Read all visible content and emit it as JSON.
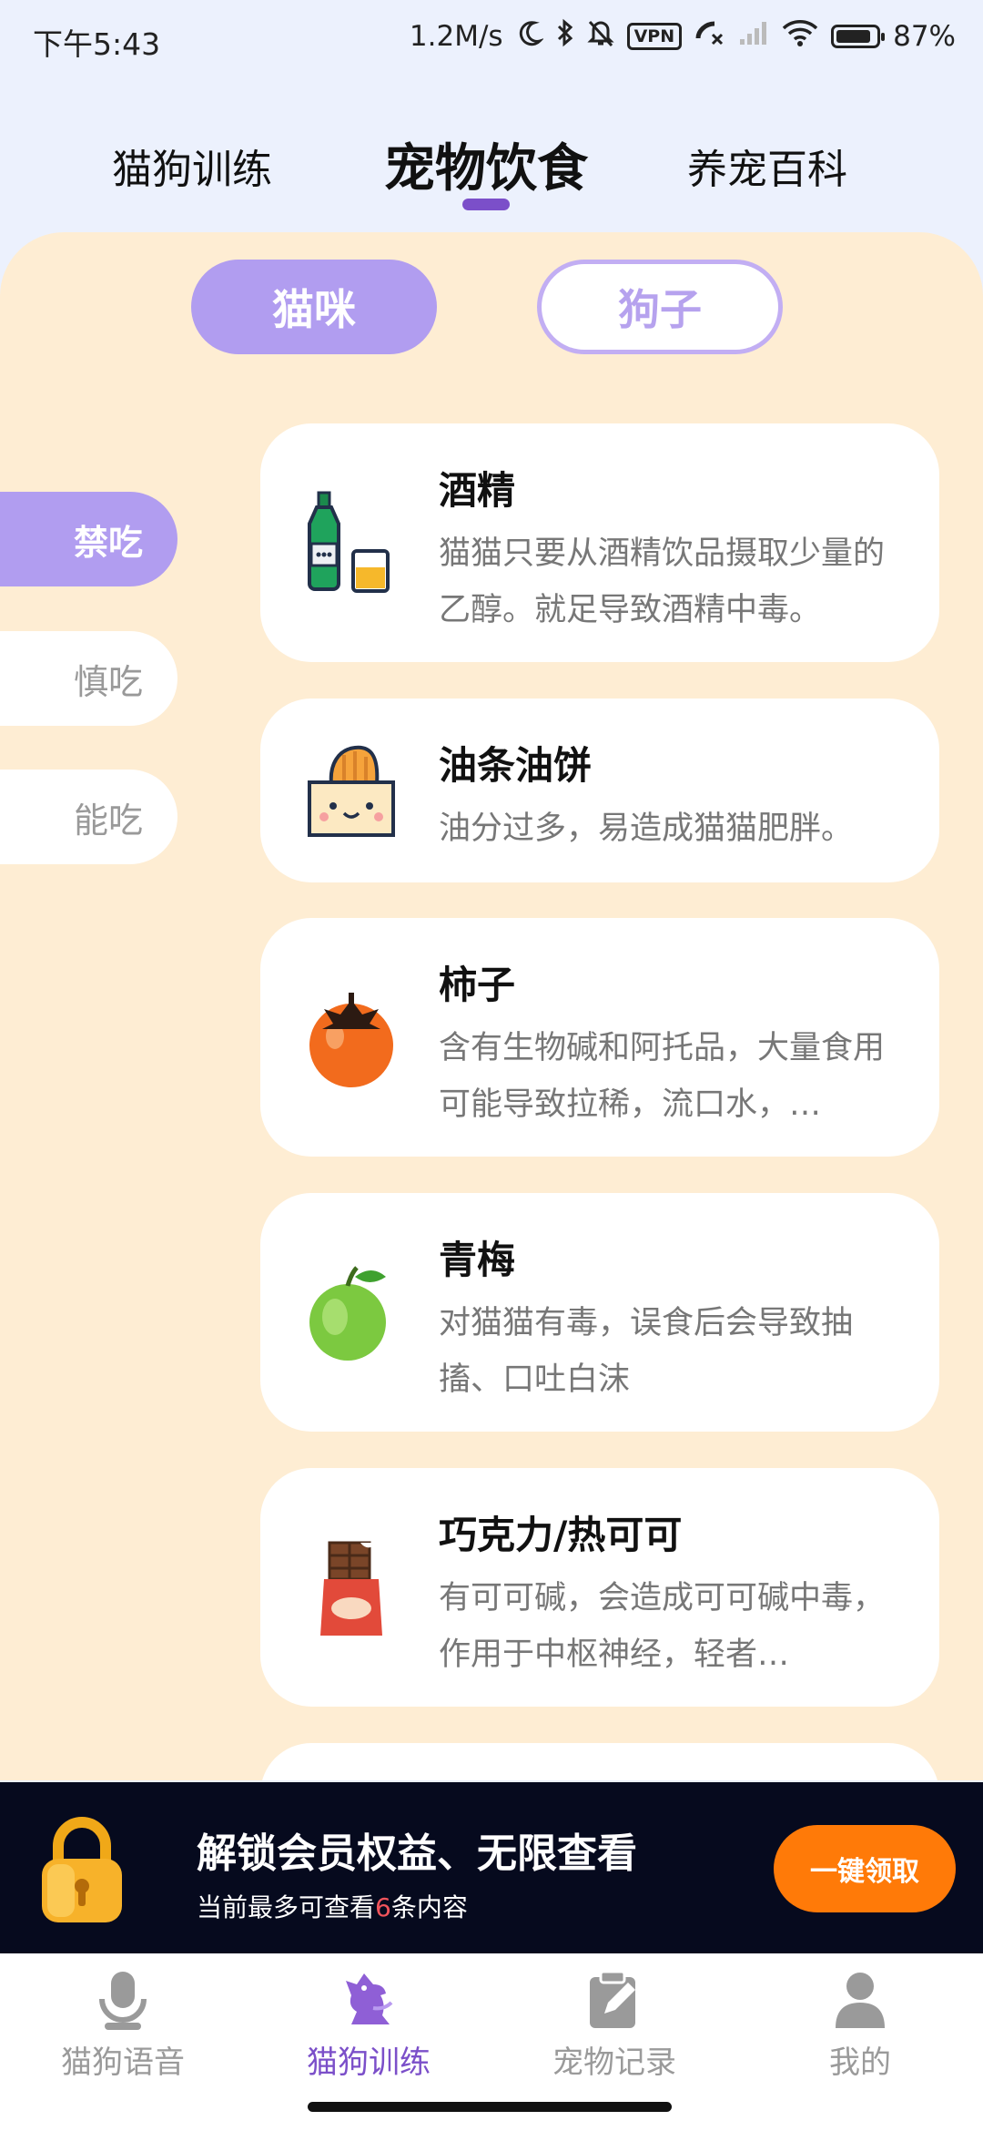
{
  "status_bar": {
    "time": "下午5:43",
    "net_speed": "1.2M/s",
    "vpn": "VPN",
    "battery": "87%",
    "battery_level": 0.87,
    "icons": [
      "moon-icon",
      "bluetooth-icon",
      "mute-icon",
      "vpn-icon",
      "call-icon",
      "signal-icon",
      "wifi-icon",
      "battery-icon"
    ]
  },
  "top_tabs": [
    {
      "label": "猫狗训练",
      "active": false
    },
    {
      "label": "宠物饮食",
      "active": true
    },
    {
      "label": "养宠百科",
      "active": false
    }
  ],
  "segment": {
    "cat": "猫咪",
    "dog": "狗子",
    "selected": "猫咪"
  },
  "side_tabs": [
    {
      "label": "禁吃",
      "active": true
    },
    {
      "label": "慎吃",
      "active": false
    },
    {
      "label": "能吃",
      "active": false
    }
  ],
  "foods": [
    {
      "title": "酒精",
      "desc": "猫猫只要从酒精饮品摄取少量的乙醇。就足导致酒精中毒。",
      "icon": "wine-bottle-icon"
    },
    {
      "title": "油条油饼",
      "desc": "油分过多，易造成猫猫肥胖。",
      "icon": "fried-dough-icon"
    },
    {
      "title": "柿子",
      "desc": "含有生物碱和阿托品，大量食用可能导致拉稀，流口水，…",
      "icon": "persimmon-icon"
    },
    {
      "title": "青梅",
      "desc": "对猫猫有毒，误食后会导致抽搐、口吐白沫",
      "icon": "green-plum-icon"
    },
    {
      "title": "巧克力/热可可",
      "desc": "有可可碱，会造成可可碱中毒，作用于中枢神经，轻者…",
      "icon": "chocolate-icon"
    }
  ],
  "promo": {
    "title": "解锁会员权益、无限查看",
    "sub_prefix": "当前最多可查看",
    "sub_count": "6",
    "sub_suffix": "条内容",
    "button": "一键领取"
  },
  "bottom_nav": [
    {
      "label": "猫狗语音",
      "active": false,
      "icon": "microphone-icon"
    },
    {
      "label": "猫狗训练",
      "active": true,
      "icon": "dog-icon"
    },
    {
      "label": "宠物记录",
      "active": false,
      "icon": "notepad-icon"
    },
    {
      "label": "我的",
      "active": false,
      "icon": "person-icon"
    }
  ],
  "colors": {
    "accent": "#7B4FC9",
    "chip": "#B19DF0",
    "panel": "#FEEDD3",
    "promo_button": "#FF7A08"
  }
}
